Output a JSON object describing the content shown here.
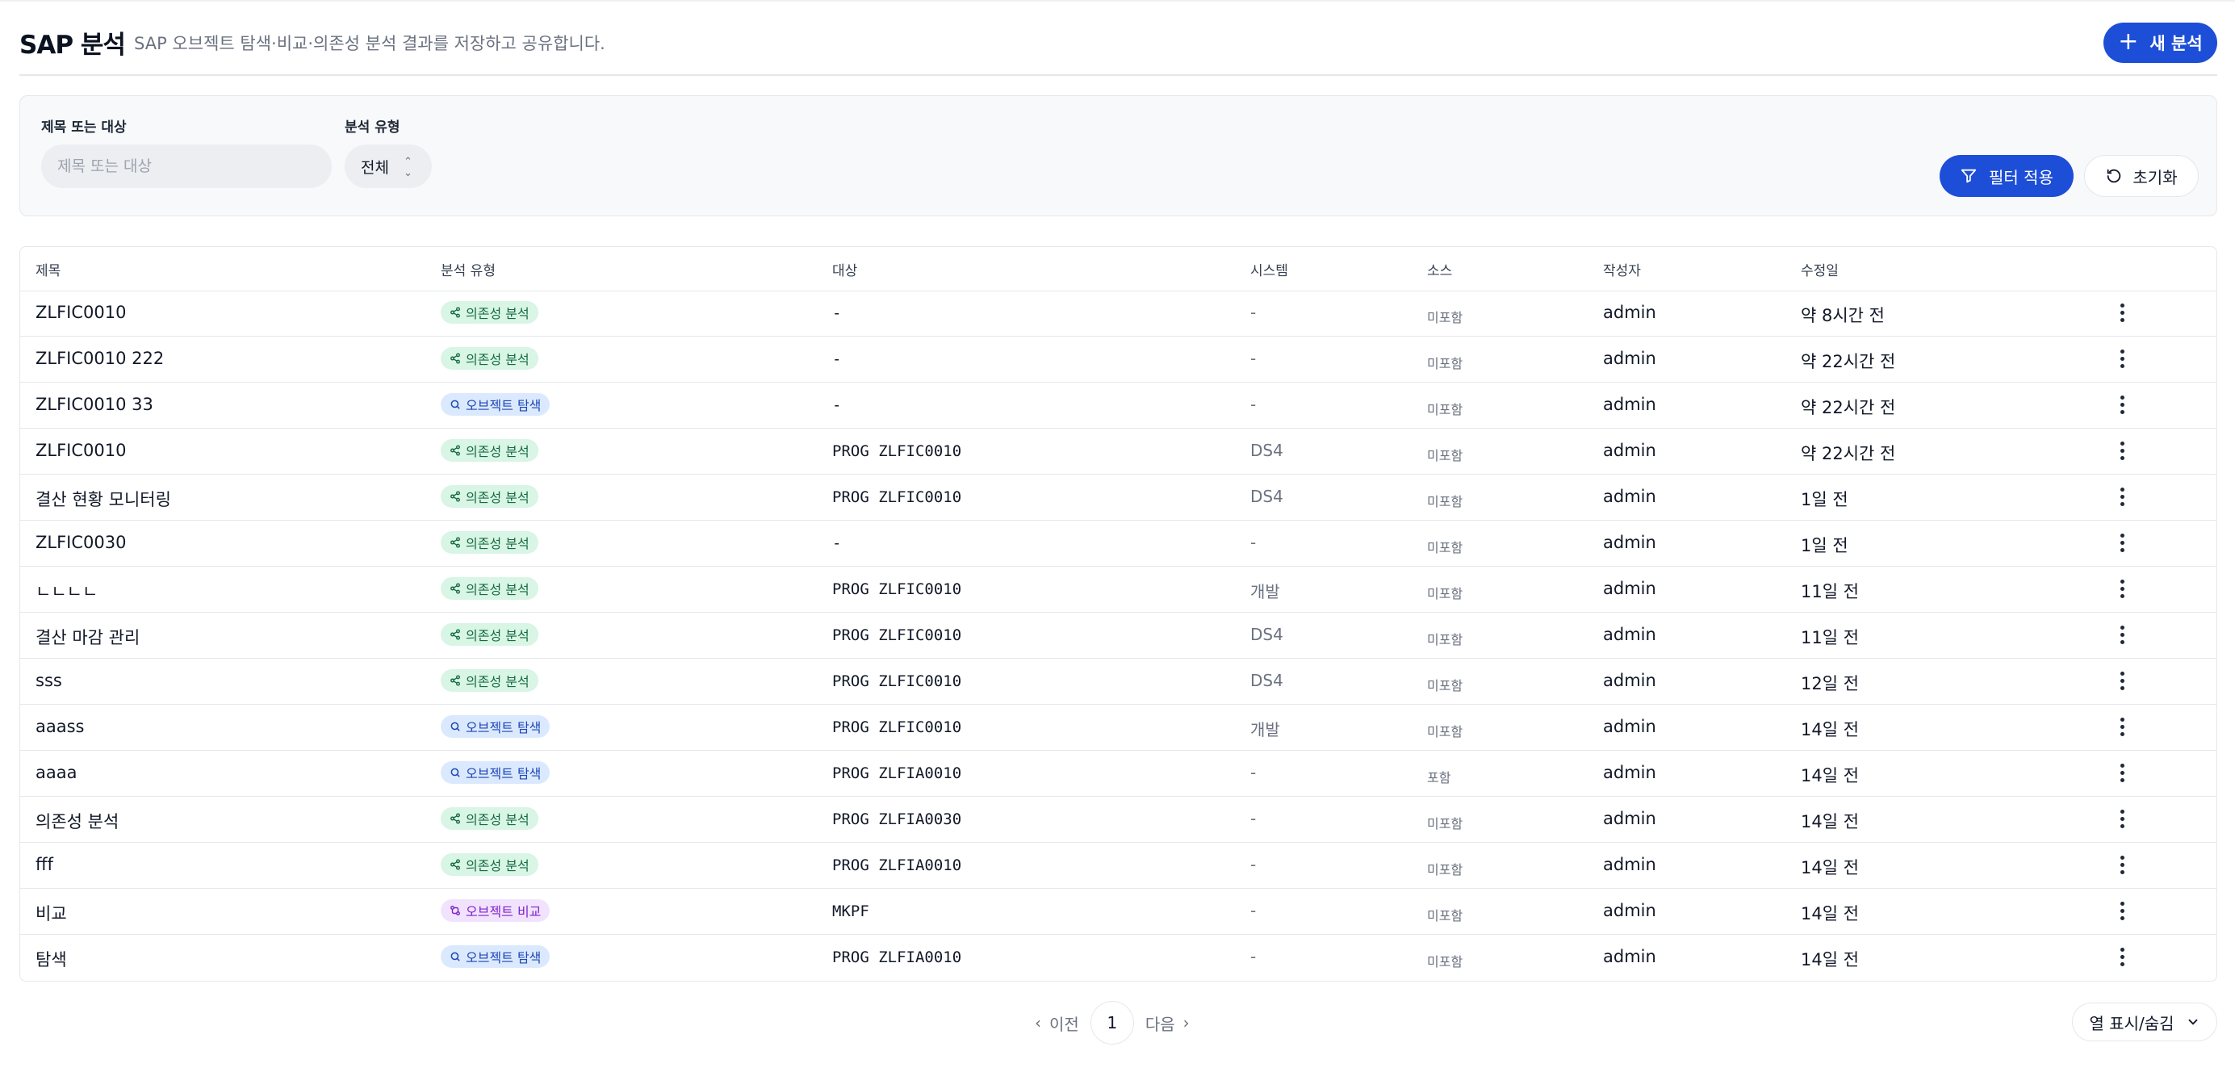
{
  "header": {
    "title": "SAP 분석",
    "subtitle": "SAP 오브젝트 탐색·비교·의존성 분석 결과를 저장하고 공유합니다.",
    "new_button": "새 분석"
  },
  "filters": {
    "title_label": "제목 또는 대상",
    "title_placeholder": "제목 또는 대상",
    "type_label": "분석 유형",
    "type_value": "전체",
    "apply_button": "필터 적용",
    "reset_button": "초기화"
  },
  "table": {
    "columns": [
      "제목",
      "분석 유형",
      "대상",
      "시스템",
      "소스",
      "작성자",
      "수정일"
    ],
    "rows": [
      {
        "title": "ZLFIC0010",
        "type": "의존성 분석",
        "kind": "dep",
        "target": "-",
        "system": "-",
        "source": "미포함",
        "author": "admin",
        "modified": "약 8시간 전"
      },
      {
        "title": "ZLFIC0010 222",
        "type": "의존성 분석",
        "kind": "dep",
        "target": "-",
        "system": "-",
        "source": "미포함",
        "author": "admin",
        "modified": "약 22시간 전"
      },
      {
        "title": "ZLFIC0010 33",
        "type": "오브젝트 탐색",
        "kind": "exp",
        "target": "-",
        "system": "-",
        "source": "미포함",
        "author": "admin",
        "modified": "약 22시간 전"
      },
      {
        "title": "ZLFIC0010",
        "type": "의존성 분석",
        "kind": "dep",
        "target": "PROG ZLFIC0010",
        "system": "DS4",
        "source": "미포함",
        "author": "admin",
        "modified": "약 22시간 전"
      },
      {
        "title": "결산 현황 모니터링",
        "type": "의존성 분석",
        "kind": "dep",
        "target": "PROG ZLFIC0010",
        "system": "DS4",
        "source": "미포함",
        "author": "admin",
        "modified": "1일 전"
      },
      {
        "title": "ZLFIC0030",
        "type": "의존성 분석",
        "kind": "dep",
        "target": "-",
        "system": "-",
        "source": "미포함",
        "author": "admin",
        "modified": "1일 전"
      },
      {
        "title": "ㄴㄴㄴㄴ",
        "type": "의존성 분석",
        "kind": "dep",
        "target": "PROG ZLFIC0010",
        "system": "개발",
        "source": "미포함",
        "author": "admin",
        "modified": "11일 전"
      },
      {
        "title": "결산 마감 관리",
        "type": "의존성 분석",
        "kind": "dep",
        "target": "PROG ZLFIC0010",
        "system": "DS4",
        "source": "미포함",
        "author": "admin",
        "modified": "11일 전"
      },
      {
        "title": "sss",
        "type": "의존성 분석",
        "kind": "dep",
        "target": "PROG ZLFIC0010",
        "system": "DS4",
        "source": "미포함",
        "author": "admin",
        "modified": "12일 전"
      },
      {
        "title": "aaass",
        "type": "오브젝트 탐색",
        "kind": "exp",
        "target": "PROG ZLFIC0010",
        "system": "개발",
        "source": "미포함",
        "author": "admin",
        "modified": "14일 전"
      },
      {
        "title": "aaaa",
        "type": "오브젝트 탐색",
        "kind": "exp",
        "target": "PROG ZLFIA0010",
        "system": "-",
        "source": "포함",
        "author": "admin",
        "modified": "14일 전"
      },
      {
        "title": "의존성 분석",
        "type": "의존성 분석",
        "kind": "dep",
        "target": "PROG ZLFIA0030",
        "system": "-",
        "source": "미포함",
        "author": "admin",
        "modified": "14일 전"
      },
      {
        "title": "fff",
        "type": "의존성 분석",
        "kind": "dep",
        "target": "PROG ZLFIA0010",
        "system": "-",
        "source": "미포함",
        "author": "admin",
        "modified": "14일 전"
      },
      {
        "title": "비교",
        "type": "오브젝트 비교",
        "kind": "cmp",
        "target": "MKPF",
        "system": "-",
        "source": "미포함",
        "author": "admin",
        "modified": "14일 전"
      },
      {
        "title": "탐색",
        "type": "오브젝트 탐색",
        "kind": "exp",
        "target": "PROG ZLFIA0010",
        "system": "-",
        "source": "미포함",
        "author": "admin",
        "modified": "14일 전"
      }
    ]
  },
  "pagination": {
    "prev": "이전",
    "page": "1",
    "next": "다음"
  },
  "column_toggle": "열 표시/숨김",
  "colors": {
    "accent": "#1d4ed8",
    "dependency_badge": "#d8f5e6",
    "explore_badge": "#dbe9fe",
    "compare_badge": "#f1e3fd"
  }
}
